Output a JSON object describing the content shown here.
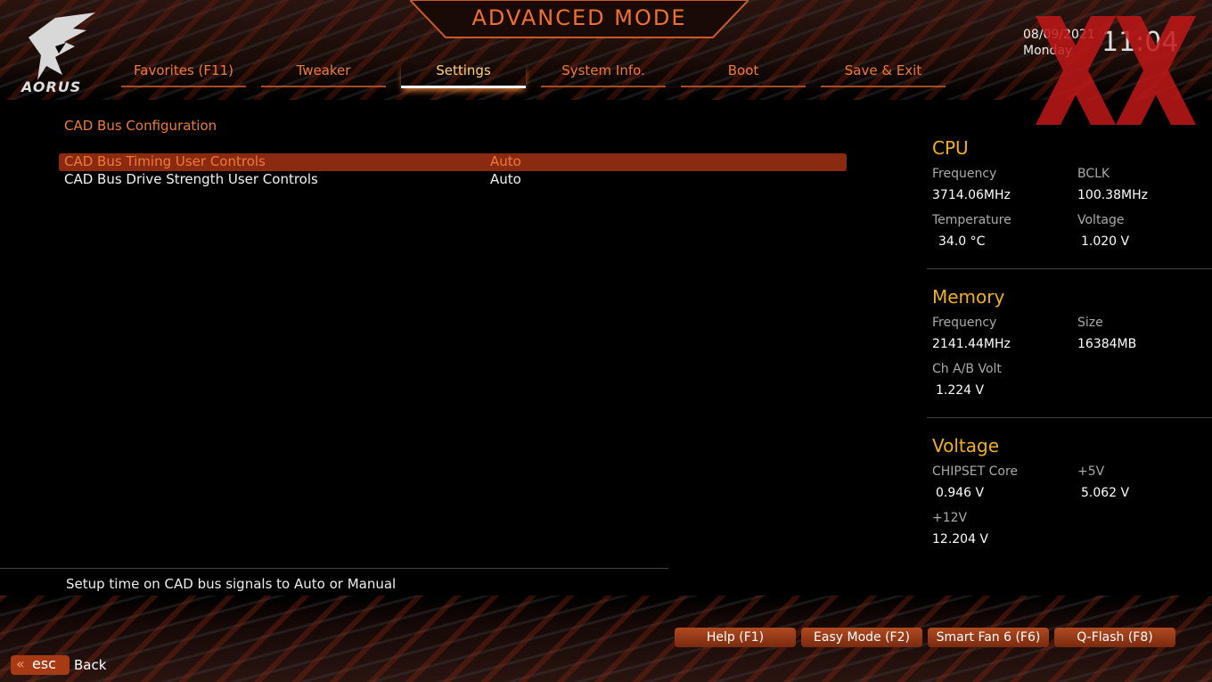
{
  "header": {
    "title": "ADVANCED MODE",
    "brand": "AORUS",
    "date": "08/09/2021",
    "day": "Monday",
    "time": "11:04"
  },
  "tabs": [
    {
      "label": "Favorites (F11)"
    },
    {
      "label": "Tweaker"
    },
    {
      "label": "Settings",
      "active": true
    },
    {
      "label": "System Info."
    },
    {
      "label": "Boot"
    },
    {
      "label": "Save & Exit"
    }
  ],
  "main": {
    "section_title": "CAD Bus Configuration",
    "items": [
      {
        "label": "CAD Bus Timing User Controls",
        "value": "Auto"
      },
      {
        "label": "CAD Bus Drive Strength User Controls",
        "value": "Auto"
      }
    ],
    "help": "Setup time on CAD bus signals to Auto or Manual"
  },
  "sidebar": {
    "cpu": {
      "heading": "CPU",
      "freq_label": "Frequency",
      "freq": "3714.06MHz",
      "bclk_label": "BCLK",
      "bclk": "100.38MHz",
      "temp_label": "Temperature",
      "temp": "34.0 °C",
      "volt_label": "Voltage",
      "volt": "1.020 V"
    },
    "memory": {
      "heading": "Memory",
      "freq_label": "Frequency",
      "freq": "2141.44MHz",
      "size_label": "Size",
      "size": "16384MB",
      "chvolt_label": "Ch A/B Volt",
      "chvolt": "1.224 V"
    },
    "voltage": {
      "heading": "Voltage",
      "chipset_label": "CHIPSET Core",
      "chipset": "0.946 V",
      "p5_label": "+5V",
      "p5": "5.062 V",
      "p12_label": "+12V",
      "p12": "12.204 V"
    }
  },
  "footer": {
    "buttons": [
      {
        "label": "Help (F1)"
      },
      {
        "label": "Easy Mode (F2)"
      },
      {
        "label": "Smart Fan 6 (F6)"
      },
      {
        "label": "Q-Flash (F8)"
      }
    ],
    "esc_key": "esc",
    "esc_label": "Back"
  },
  "colors": {
    "accent": "#f07a3a",
    "heading": "#f0b020",
    "selected": "#8a2a10"
  }
}
